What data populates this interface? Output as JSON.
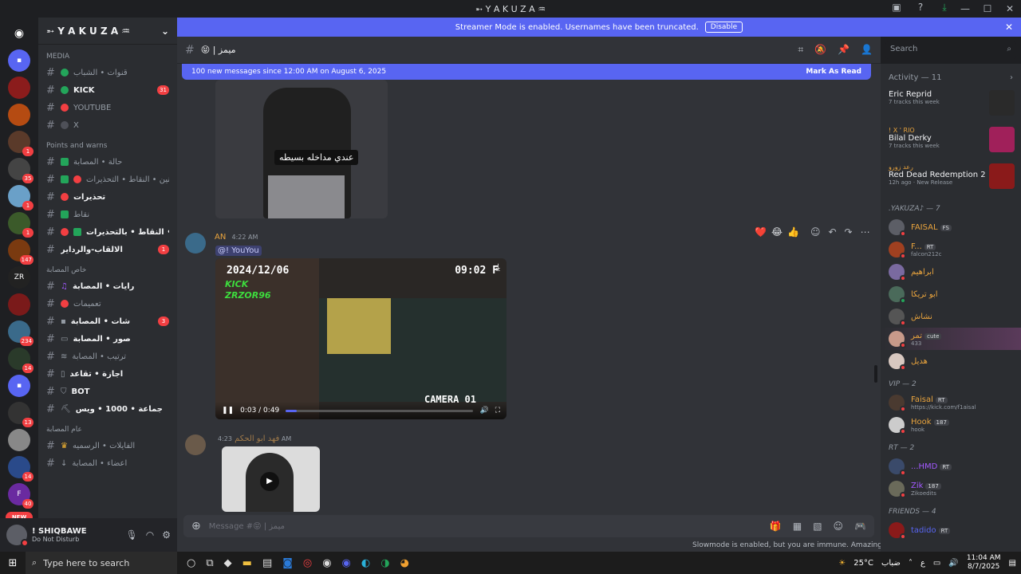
{
  "window": {
    "title": "➵ Y A K U Z A ♒"
  },
  "banner": {
    "text": "Streamer Mode is enabled. Usernames have been truncated.",
    "button": "Disable"
  },
  "servers": {
    "badges": [
      "1",
      "35",
      "1",
      "1",
      "147",
      "234",
      "14",
      "13",
      "14",
      "40"
    ],
    "new_label": "NEW"
  },
  "guild": {
    "name": "➵ Y A K U Z A ♒",
    "categories": {
      "media": "MEDIA",
      "points": "Points and warns",
      "special": "خاص المصابة",
      "general": "عام المصابة"
    },
    "channels": [
      {
        "name": "قنوات • الشباب",
        "icon": "green-dot"
      },
      {
        "name": "KICK",
        "icon": "green-dot",
        "badge": "31",
        "bold": true
      },
      {
        "name": "YOUTUBE",
        "icon": "red-dot"
      },
      {
        "name": "X",
        "icon": "dark-dot"
      },
      {
        "name": "حالة • المصابة",
        "icon": "green-square"
      },
      {
        "name": "قوانين • النقاط • التحذيرات",
        "icon": "check-no"
      },
      {
        "name": "تحذيرات",
        "icon": "no-entry",
        "bold": true
      },
      {
        "name": "نقاط",
        "icon": "green-square"
      },
      {
        "name": "ال • النقاط • بالتحذيرات",
        "icon": "no-check",
        "bold": true
      },
      {
        "name": "الالقاب-والرداير",
        "icon": "none",
        "badge": "1",
        "bold": true
      },
      {
        "name": "رايات • المصابة",
        "icon": "music",
        "bold": true
      },
      {
        "name": "تعميمات",
        "icon": "red-dot"
      },
      {
        "name": "شات • المصابة",
        "icon": "chat",
        "badge": "3",
        "bold": true
      },
      {
        "name": "صور • المصابة",
        "icon": "frame",
        "bold": true
      },
      {
        "name": "ترتيب • المصابة",
        "icon": "crab"
      },
      {
        "name": "اجازة • تقاعد",
        "icon": "scroll",
        "bold": true
      },
      {
        "name": "BOT",
        "icon": "shield",
        "bold": true
      },
      {
        "name": "جماعة • 1000 • ويس",
        "icon": "pick",
        "bold": true
      },
      {
        "name": "الفايلات • الرسميه",
        "icon": "trophy"
      },
      {
        "name": "اعضاء • المصابة",
        "icon": "pin"
      }
    ]
  },
  "user": {
    "name": "! SHIQBAWE",
    "status": "Do Not Disturb"
  },
  "header": {
    "channel": "😝 | ميمز",
    "search_placeholder": "Search"
  },
  "newbar": {
    "text": "100 new messages since 12:00 AM on August 6, 2025",
    "action": "Mark As Read"
  },
  "messages": {
    "image_caption": "عندي مداخله بسيطه",
    "m1": {
      "author": "AN",
      "time": "4:22 AM",
      "mention": "@! YouYou"
    },
    "video": {
      "date": "2024/12/06",
      "clock": "09:02 F",
      "kick": "KICK",
      "handle": "ZRZOR96",
      "camera": "CAMERA 01",
      "time": "0:03 / 0:49",
      "progress": 0.06
    },
    "m2": {
      "author": "فهد ابو الحكم",
      "time": "4:23 AM"
    },
    "reactions": [
      "❤️",
      "😂",
      "👍"
    ]
  },
  "composer": {
    "placeholder": "Message #😝 | ميمز",
    "slowmode": "Slowmode is enabled, but you are immune. Amazing!"
  },
  "activity": {
    "title": "Activity — 11",
    "items": [
      {
        "user": "",
        "title": "Eric Reprid",
        "sub": "7 tracks this week"
      },
      {
        "user": "! X ' RIO",
        "title": "Bilal Derky",
        "sub": "7 tracks this week"
      },
      {
        "user": "رعد زورو",
        "title": "Red Dead Redemption 2",
        "sub": "12h ago",
        "extra": "New Release"
      }
    ]
  },
  "member_groups": {
    "yakuza": ".YAKUZA♪ — 7",
    "vip": "VIP — 2",
    "rt": "RT — 2",
    "friends": "FRIENDS — 4"
  },
  "members": [
    {
      "name": "FAISAL",
      "tag": "FS",
      "color": "#e8a33d",
      "sub": ""
    },
    {
      "name": "F...",
      "tag": "RT",
      "color": "#e8a33d",
      "sub": "falcon212c"
    },
    {
      "name": "ابراهيم",
      "tag": "",
      "color": "#e8a33d",
      "sub": ""
    },
    {
      "name": "ابو تريكا",
      "tag": "",
      "color": "#e8a33d",
      "sub": ""
    },
    {
      "name": "نشاش",
      "tag": "",
      "color": "#e8a33d",
      "sub": ""
    },
    {
      "name": "تمر",
      "tag": "cute",
      "color": "#e8a33d",
      "sub": "433"
    },
    {
      "name": "هديل",
      "tag": "",
      "color": "#e8a33d",
      "sub": ""
    },
    {
      "name": "Faisal",
      "tag": "RT",
      "color": "#e8a33d",
      "sub": "https://kick.com/f1aisal"
    },
    {
      "name": "Hook",
      "tag": "187",
      "color": "#e8a33d",
      "sub": "hook"
    },
    {
      "name": "...HMD",
      "tag": "RT",
      "color": "#a259ff",
      "sub": ""
    },
    {
      "name": "Zik",
      "tag": "187",
      "color": "#a259ff",
      "sub": "Zikoedits"
    },
    {
      "name": "tadido",
      "tag": "RT",
      "color": "#5865f2",
      "sub": ""
    }
  ],
  "taskbar": {
    "search_placeholder": "Type here to search",
    "weather": "25°C",
    "weather_text": "ضباب",
    "lang": "ع",
    "time": "11:04 AM",
    "date": "8/7/2025"
  }
}
